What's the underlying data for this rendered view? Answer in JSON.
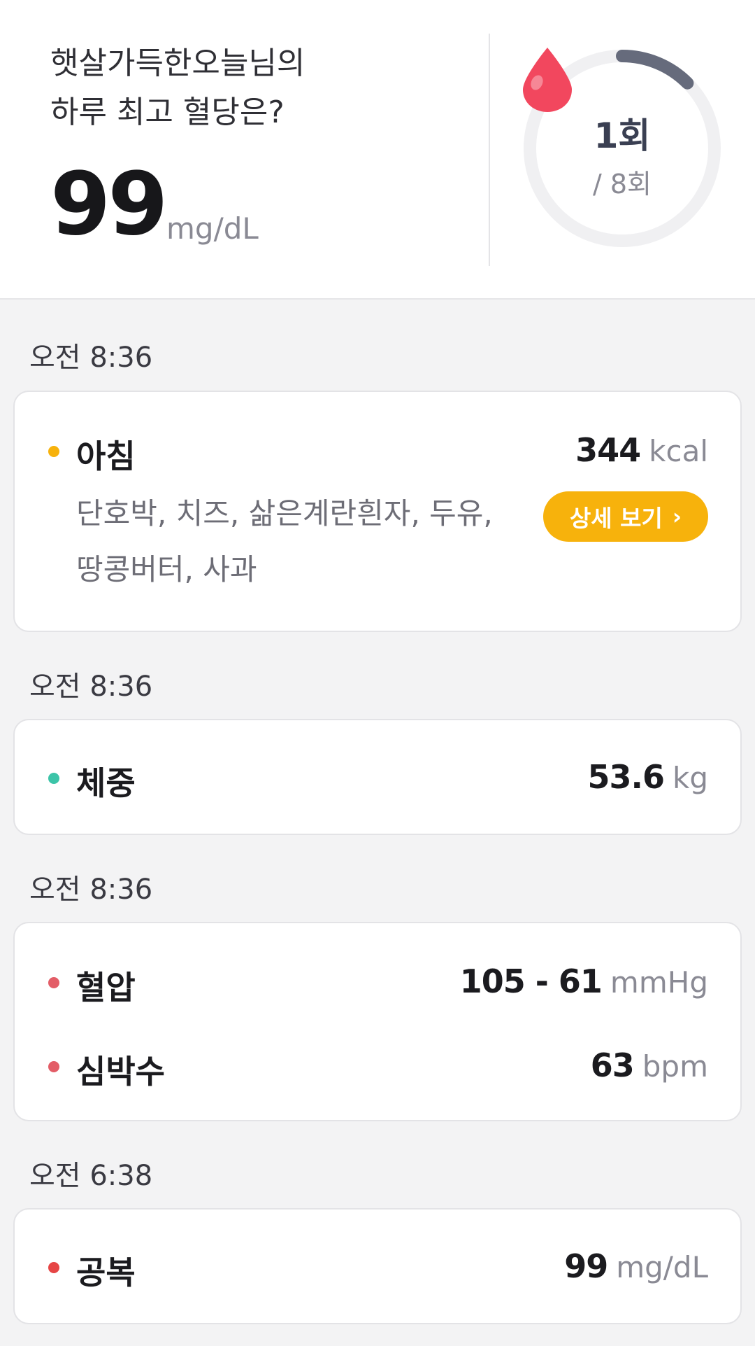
{
  "summary": {
    "title_line1": "햇살가득한오늘님의",
    "title_line2": "하루 최고 혈당은?",
    "max_glucose": "99",
    "glucose_unit": "mg/dL",
    "ring": {
      "count": "1회",
      "total": "/ 8회",
      "progress_fraction": 0.125,
      "track_color": "#f0f0f2",
      "progress_color": "#666b7c",
      "drop_color": "#f2475e"
    }
  },
  "timeline": [
    {
      "time": "오전 8:36",
      "meal": {
        "label": "아침",
        "dot_color": "#f7b20c",
        "value": "344",
        "unit": "kcal",
        "items_line1": "단호박, 치즈, 삶은계란흰자, 두유,",
        "items_line2": "땅콩버터, 사과",
        "detail_button": "상세 보기",
        "detail_icon": "chevron-right-icon"
      }
    },
    {
      "time": "오전 8:36",
      "weight": {
        "label": "체중",
        "dot_color": "#3cc4a8",
        "value": "53.6",
        "unit": "kg"
      }
    },
    {
      "time": "오전 8:36",
      "blood_pressure": {
        "label": "혈압",
        "dot_color": "#e35d67",
        "value": "105 - 61",
        "unit": "mmHg"
      },
      "heart_rate": {
        "label": "심박수",
        "dot_color": "#e35d67",
        "value": "63",
        "unit": "bpm"
      }
    },
    {
      "time": "오전 6:38",
      "fasting": {
        "label": "공복",
        "dot_color": "#e64545",
        "value": "99",
        "unit": "mg/dL"
      }
    }
  ]
}
